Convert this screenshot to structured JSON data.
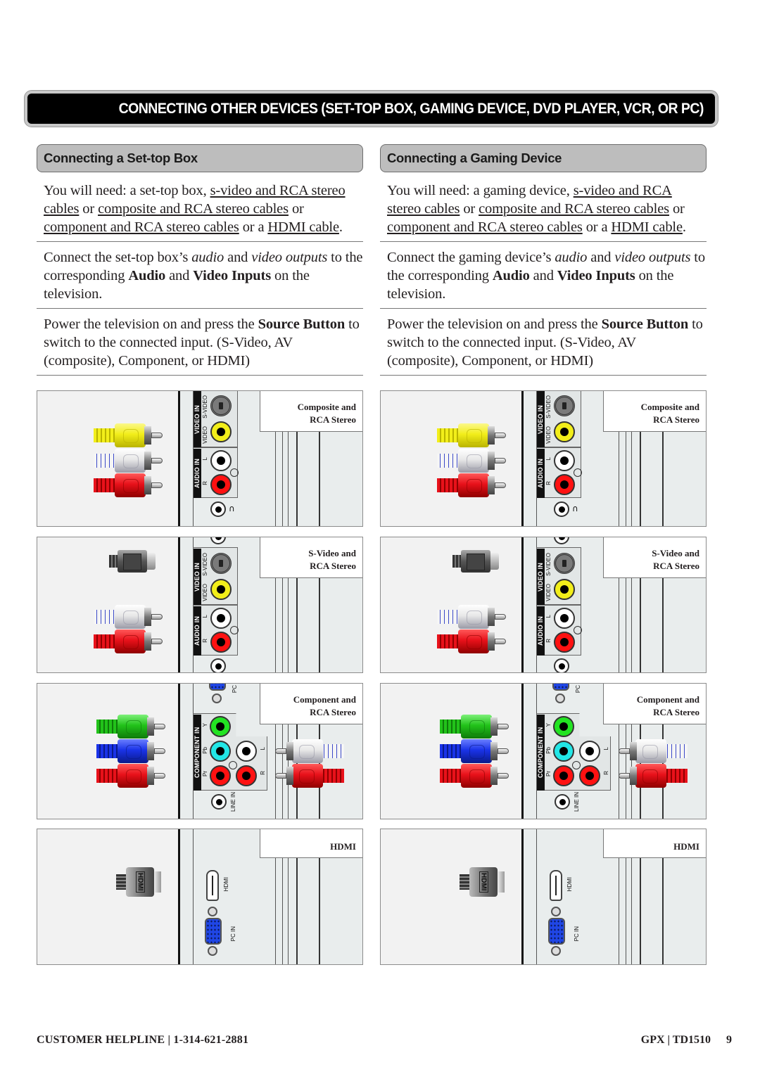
{
  "banner": {
    "title": "CONNECTING OTHER DEVICES (SET-TOP BOX, GAMING DEVICE, DVD PLAYER, VCR, OR PC)"
  },
  "sections": [
    {
      "heading": "Connecting a Set-top Box",
      "need": {
        "prefix": "You  will need: a set-top box, ",
        "link1": "s-video and RCA stereo cables",
        "or1": " or ",
        "link2": "composite and RCA stereo cables",
        "or2": " or ",
        "link3": "component and RCA stereo cables",
        "or3": " or a ",
        "link4": "HDMI cable",
        "suffix": "."
      },
      "connect": {
        "t1": "Connect the set-top box’s ",
        "i1": "audio",
        "t2": " and ",
        "i2": "video outputs",
        "t3": " to the corresponding ",
        "b1": "Audio",
        "t4": " and ",
        "b2": "Video Inputs",
        "t5": " on the television."
      },
      "power": {
        "t1": "Power the television on and press the ",
        "b1": "Source Button",
        "t2": " to switch to the connected input. (S-Video, AV (composite), Component, or HDMI)"
      }
    },
    {
      "heading": "Connecting a Gaming Device",
      "need": {
        "prefix": "You  will need: a gaming device, ",
        "link1": "s-video and RCA stereo cables",
        "or1": " or ",
        "link2": "composite and RCA stereo cables",
        "or2": " or ",
        "link3": "component and RCA stereo cables",
        "or3": " or a ",
        "link4": "HDMI cable",
        "suffix": "."
      },
      "connect": {
        "t1": "Connect the gaming device’s ",
        "i1": "audio",
        "t2": " and ",
        "i2": "video outputs",
        "t3": " to the corresponding ",
        "b1": "Audio",
        "t4": " and ",
        "b2": "Video Inputs",
        "t5": " on the television."
      },
      "power": {
        "t1": "Power the television on and press the ",
        "b1": "Source Button",
        "t2": " to switch to the connected input. (S-Video, AV (composite), Component, or HDMI)"
      }
    }
  ],
  "diagrams": {
    "composite": {
      "caption_line1": "Composite and",
      "caption_line2": "RCA Stereo"
    },
    "svideo": {
      "caption_line1": "S-Video and",
      "caption_line2": "RCA Stereo"
    },
    "component": {
      "caption_line1": "Component and",
      "caption_line2": "RCA Stereo"
    },
    "hdmi": {
      "caption_line1": "HDMI"
    }
  },
  "panel_labels": {
    "video_in": "VIDEO IN",
    "audio_in": "AUDIO IN",
    "component_in": "COMPONENT IN",
    "s_video": "S-VIDEO",
    "video": "VIDEO",
    "l": "L",
    "r": "R",
    "y": "Y",
    "pb": "Pb",
    "pr": "Pr",
    "line_in": "LINE IN",
    "hdmi": "HDMI",
    "pc_in": "PC IN",
    "pc": "PC",
    "hdmi_plug": "HDMI",
    "headphone_glyph": "Ω"
  },
  "colors": {
    "banner_bg": "#000000",
    "section_header_bg": "#bdbdbd",
    "rca_yellow": "#f2ee1a",
    "rca_white": "#e8e8e8",
    "rca_red": "#e8111a",
    "component_green": "#22c21a",
    "component_blue": "#1a33e8",
    "component_cyan": "#22e6e6",
    "vga_blue": "#2046e6"
  },
  "footer": {
    "helpline": "CUSTOMER HELPLINE  |  1-314-621-2881",
    "brand_model": "GPX  |  TD1510",
    "page_number": "9"
  }
}
